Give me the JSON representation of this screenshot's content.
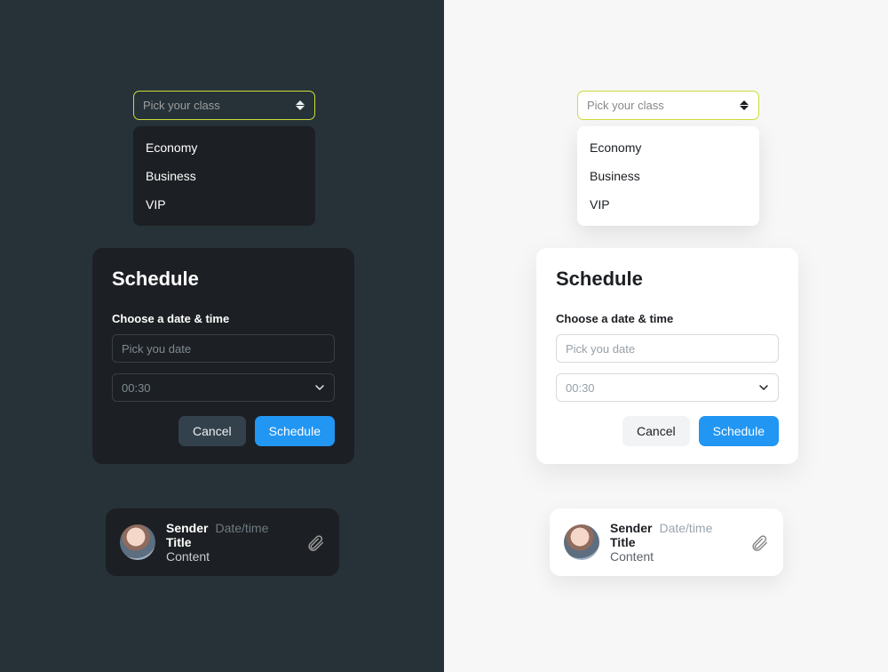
{
  "picker": {
    "placeholder": "Pick your class",
    "options": [
      {
        "label": "Economy"
      },
      {
        "label": "Business"
      },
      {
        "label": "VIP"
      }
    ]
  },
  "schedule": {
    "title": "Schedule",
    "subtitle": "Choose a date & time",
    "date_placeholder": "Pick you date",
    "time_value": "00:30",
    "cancel": "Cancel",
    "submit": "Schedule"
  },
  "message": {
    "sender": "Sender",
    "datetime": "Date/time",
    "title": "Title",
    "content": "Content"
  },
  "colors": {
    "accent_yellow": "#cddc39",
    "primary_blue": "#2196f3",
    "dark_bg": "#263238",
    "dark_surface": "#1c1f23",
    "light_bg": "#f7f7f8"
  }
}
